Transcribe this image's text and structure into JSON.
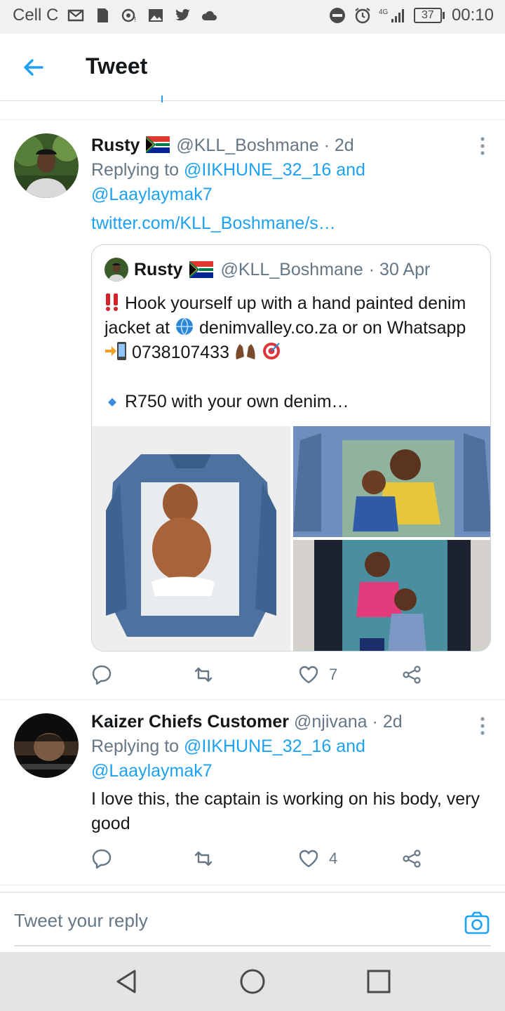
{
  "status_bar": {
    "carrier": "Cell C",
    "network": "4G",
    "battery": "37",
    "time": "00:10"
  },
  "header": {
    "title": "Tweet"
  },
  "tweets": [
    {
      "name": "Rusty",
      "handle": "@KLL_Boshmane",
      "time": "· 2d",
      "replying_prefix": "Replying to",
      "replying_to_1": "@IIKHUNE_32_16",
      "replying_and": "and",
      "replying_to_2": "@Laaylaymak7",
      "link": "twitter.com/KLL_Boshmane/s…",
      "quote": {
        "name": "Rusty",
        "handle": "@KLL_Boshmane",
        "time": "· 30 Apr",
        "line1": "Hook yourself up with a hand painted denim jacket at",
        "site": "denimvalley.co.za",
        "line2": "or on Whatsapp",
        "phone": "0738107433",
        "line3": "R750 with your own denim…"
      },
      "likes": "7"
    },
    {
      "name": "Kaizer Chiefs Customer",
      "handle": "@njivana",
      "time": "· 2d",
      "replying_prefix": "Replying to",
      "replying_to_1": "@IIKHUNE_32_16",
      "replying_and": "and",
      "replying_to_2": "@Laaylaymak7",
      "text": "I love this, the captain is working on his body, very good",
      "likes": "4"
    }
  ],
  "reply": {
    "placeholder": "Tweet your reply"
  },
  "colors": {
    "accent": "#1da1f2",
    "muted": "#657786"
  }
}
